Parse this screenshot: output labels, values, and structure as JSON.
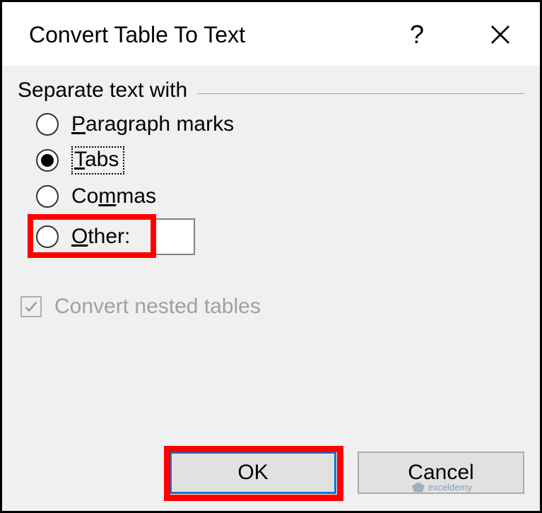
{
  "title": "Convert Table To Text",
  "help_tooltip": "Help",
  "close_tooltip": "Close",
  "fieldset_label": "Separate text with",
  "options": {
    "paragraph": {
      "label_pre": "",
      "label_u": "P",
      "label_post": "aragraph marks",
      "selected": false
    },
    "tabs": {
      "label_pre": "",
      "label_u": "T",
      "label_post": "abs",
      "selected": true
    },
    "commas": {
      "label_pre": "Co",
      "label_u": "m",
      "label_post": "mas",
      "selected": false
    },
    "other": {
      "label_pre": "",
      "label_u": "O",
      "label_post": "ther:",
      "selected": false,
      "value": ""
    }
  },
  "checkbox": {
    "label": "Convert nested tables",
    "checked": true,
    "enabled": false
  },
  "buttons": {
    "ok": "OK",
    "cancel": "Cancel"
  },
  "watermark": "exceldemy"
}
